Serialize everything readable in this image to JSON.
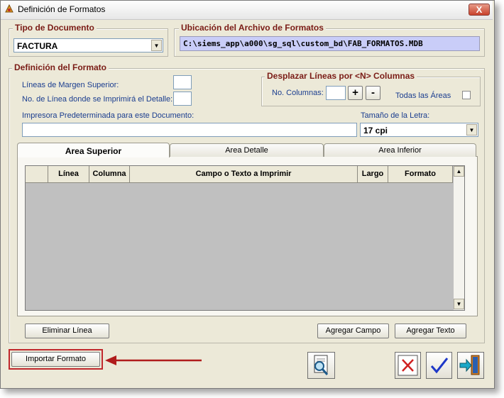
{
  "window": {
    "title": "Definición de Formatos",
    "close_label": "X"
  },
  "tipo_documento": {
    "legend": "Tipo de Documento",
    "value": "FACTURA"
  },
  "ubicacion": {
    "legend": "Ubicación del Archivo de Formatos",
    "path": "C:\\siems_app\\a000\\sg_sql\\custom_bd\\FAB_FORMATOS.MDB"
  },
  "definicion": {
    "legend": "Definición del Formato",
    "margen_label": "Líneas de Margen Superior:",
    "detalle_label": "No. de Línea donde se Imprimirá el Detalle:",
    "impresora_label": "Impresora Predeterminada para este Documento:",
    "tamano_label": "Tamaño de la Letra:",
    "tamano_value": "17 cpi"
  },
  "desplazar": {
    "legend": "Desplazar Líneas por <N> Columnas",
    "columnas_label": "No. Columnas:",
    "plus": "+",
    "minus": "-",
    "todas_label": "Todas las Áreas"
  },
  "tabs": [
    {
      "label": "Area Superior"
    },
    {
      "label": "Area Detalle"
    },
    {
      "label": "Area Inferior"
    }
  ],
  "grid": {
    "columns": [
      "",
      "Línea",
      "Columna",
      "Campo o Texto a Imprimir",
      "Largo",
      "Formato"
    ]
  },
  "buttons": {
    "eliminar": "Eliminar Línea",
    "agregar_campo": "Agregar Campo",
    "agregar_texto": "Agregar Texto",
    "importar": "Importar Formato"
  },
  "colors": {
    "highlight_box": "#c0282c",
    "path_field": "#c9cdf8",
    "legend_text": "#7a1c16",
    "label_text": "#1a3d8f"
  }
}
